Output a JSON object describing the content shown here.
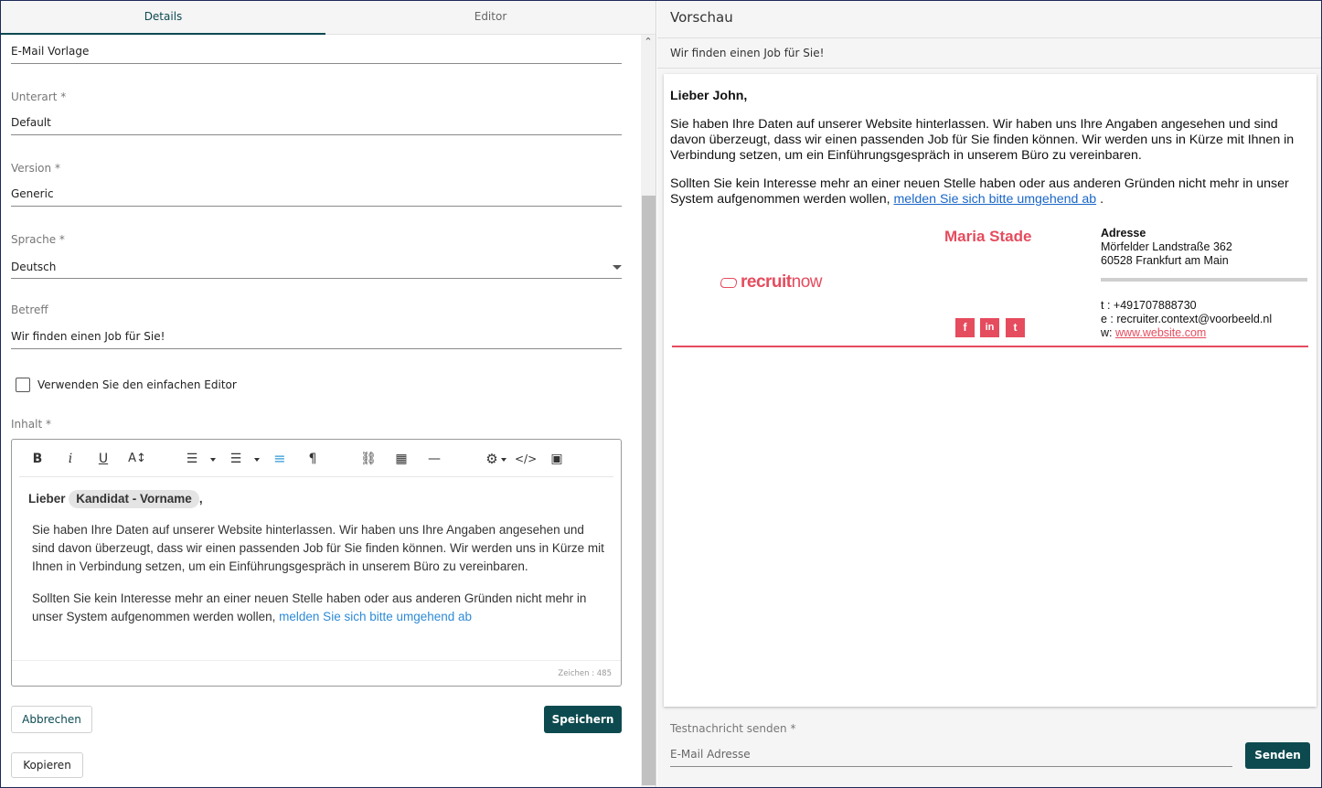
{
  "tabs": [
    "Details",
    "Editor"
  ],
  "fields": {
    "name_value": "E-Mail Vorlage",
    "unterart_label": "Unterart *",
    "unterart_value": "Default",
    "version_label": "Version *",
    "version_value": "Generic",
    "sprache_label": "Sprache *",
    "sprache_value": "Deutsch",
    "betreff_label": "Betreff",
    "betreff_value": "Wir finden einen Job für Sie!"
  },
  "checkbox": {
    "label": "Verwenden Sie den einfachen Editor",
    "checked": false
  },
  "editor": {
    "label": "Inhalt *",
    "toolbar": {
      "bold": "B",
      "italic": "i",
      "underline": "U",
      "font_size": "A↕",
      "ordered_list": "☰",
      "bullet_list": "☰",
      "align": "≡",
      "paragraph": "¶",
      "link": "⛓",
      "table": "▦",
      "hr": "—",
      "settings": "⚙",
      "code": "</>",
      "image": "▣"
    },
    "greeting_prefix": "Lieber",
    "placeholder_chip": "Kandidat - Vorname",
    "greeting_suffix": ",",
    "paragraph1": "Sie haben Ihre Daten auf unserer Website hinterlassen. Wir haben uns Ihre Angaben angesehen und sind davon überzeugt, dass wir einen passenden Job für Sie finden können. Wir werden uns in Kürze mit Ihnen in Verbindung setzen, um ein Einführungsgespräch in unserem Büro zu vereinbaren.",
    "paragraph2_prefix": "Sollten Sie kein Interesse mehr an einer neuen Stelle haben oder aus anderen Gründen nicht mehr in unser System aufgenommen werden wollen,",
    "paragraph2_link": "melden Sie sich bitte umgehend ab",
    "char_count": "Zeichen : 485"
  },
  "buttons": {
    "cancel": "Abbrechen",
    "save": "Speichern",
    "copy": "Kopieren",
    "send": "Senden"
  },
  "preview": {
    "title": "Vorschau",
    "subject": "Wir finden einen Job für Sie!",
    "greeting": "Lieber John,",
    "paragraph1": "Sie haben Ihre Daten auf unserer Website hinterlassen. Wir haben uns Ihre Angaben angesehen und sind davon überzeugt, dass wir einen passenden Job für Sie finden können. Wir werden uns in Kürze mit Ihnen in Verbindung setzen, um ein Einführungsgespräch in unserem Büro zu vereinbaren.",
    "paragraph2_prefix": "Sollten Sie kein Interesse mehr an einer neuen Stelle haben oder aus anderen Gründen nicht mehr in unser System aufgenommen werden wollen,",
    "paragraph2_link": "melden Sie sich bitte umgehend ab",
    "paragraph2_suffix": ".",
    "signature": {
      "name": "Maria Stade",
      "logo_bold": "recruit",
      "logo_light": "now",
      "address_title": "Adresse",
      "street": "Mörfelder Landstraße 362",
      "city": "60528 Frankfurt am Main",
      "phone": "t : +491707888730",
      "email": "e : recruiter.context@voorbeeld.nl",
      "web_prefix": "w:",
      "web_link": "www.website.com",
      "social": [
        "f",
        "in",
        "t"
      ]
    }
  },
  "test_message": {
    "label": "Testnachricht senden *",
    "placeholder": "E-Mail Adresse"
  },
  "colors": {
    "accent": "#0d4a4f",
    "brand": "#e54c5e",
    "link": "#1a66c8"
  }
}
